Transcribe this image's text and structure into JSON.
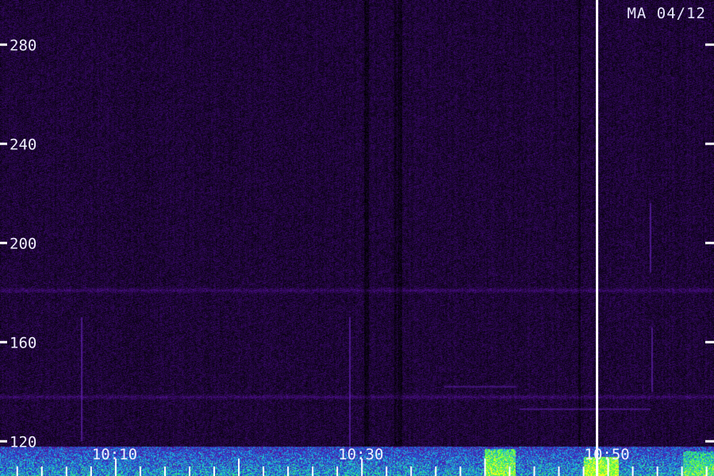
{
  "chart_data": {
    "type": "heatmap",
    "title": "",
    "station_date": "MA 04/12",
    "xlabel": "",
    "ylabel": "",
    "x_tick_labels": [
      "10:10",
      "10:30",
      "10:50"
    ],
    "x_tick_minutes": [
      10,
      30,
      50
    ],
    "x_range_minutes": [
      0.6,
      58.6
    ],
    "y_ticks": [
      120,
      160,
      200,
      240,
      280
    ],
    "y_range": [
      106,
      298
    ],
    "marker_minutes": 49.1,
    "grid": false,
    "colormap": [
      "#000000",
      "#1a0530",
      "#3b0a6e",
      "#5a1aa0",
      "#2040d0",
      "#20c0e0",
      "#40ff40",
      "#ffff20"
    ],
    "features": [
      {
        "kind": "horizontal_band",
        "value": 181,
        "label": ""
      },
      {
        "kind": "horizontal_band",
        "value": 138,
        "label": ""
      },
      {
        "kind": "noise_floor",
        "value_range": [
          106,
          118
        ],
        "label": ""
      }
    ]
  }
}
